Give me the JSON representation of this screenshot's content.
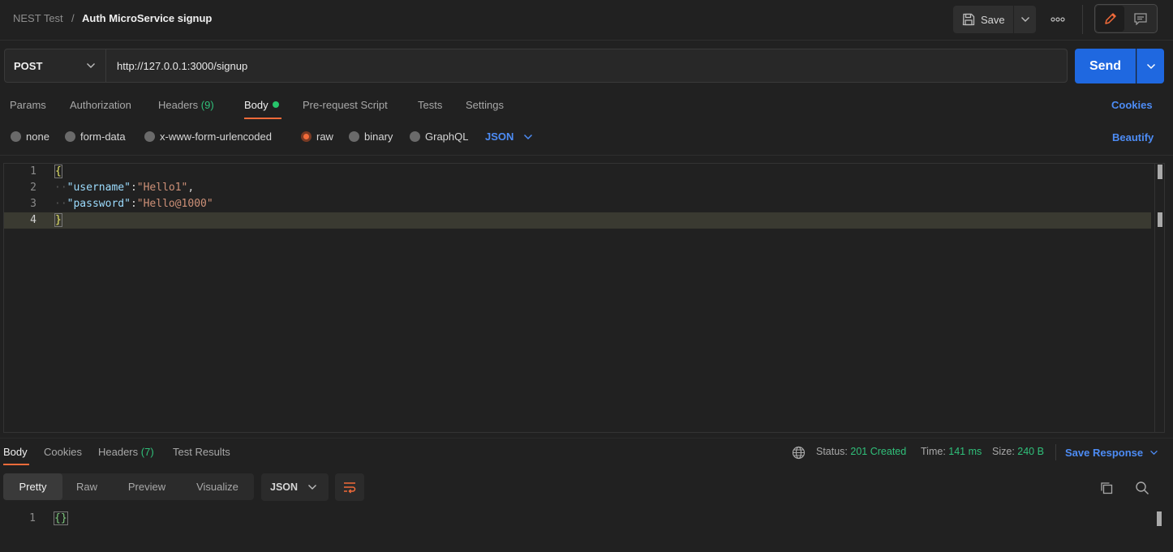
{
  "breadcrumb": {
    "collection": "NEST Test",
    "separator": "/",
    "request": "Auth MicroService signup"
  },
  "header": {
    "save_label": "Save"
  },
  "request": {
    "method": "POST",
    "url": "http://127.0.0.1:3000/signup",
    "send_label": "Send"
  },
  "request_tabs": {
    "params": "Params",
    "authorization": "Authorization",
    "headers": "Headers",
    "headers_count": "(9)",
    "body": "Body",
    "prerequest": "Pre-request Script",
    "tests": "Tests",
    "settings": "Settings",
    "cookies": "Cookies"
  },
  "body_types": {
    "none": "none",
    "form_data": "form-data",
    "urlencoded": "x-www-form-urlencoded",
    "raw": "raw",
    "binary": "binary",
    "graphql": "GraphQL",
    "language": "JSON",
    "beautify": "Beautify",
    "selected": "raw"
  },
  "editor": {
    "lines": [
      {
        "n": "1",
        "text": "{"
      },
      {
        "n": "2",
        "text": "\"username\":\"Hello1\","
      },
      {
        "n": "3",
        "text": "\"password\":\"Hello@1000\""
      },
      {
        "n": "4",
        "text": "}"
      }
    ],
    "key1": "\"username\"",
    "val1": "\"Hello1\"",
    "key2": "\"password\"",
    "val2": "\"Hello@1000\""
  },
  "response": {
    "tabs": {
      "body": "Body",
      "cookies": "Cookies",
      "headers": "Headers",
      "headers_count": "(7)",
      "test_results": "Test Results"
    },
    "status_label": "Status:",
    "status_value": "201 Created",
    "time_label": "Time:",
    "time_value": "141 ms",
    "size_label": "Size:",
    "size_value": "240 B",
    "save_response": "Save Response",
    "view_modes": {
      "pretty": "Pretty",
      "raw": "Raw",
      "preview": "Preview",
      "visualize": "Visualize"
    },
    "format": "JSON",
    "lines": [
      {
        "n": "1",
        "text": "{}"
      }
    ]
  },
  "colors": {
    "accent_orange": "#f26b3a",
    "send_blue": "#1f68e0",
    "link_blue": "#4d8cf5",
    "success_green": "#30c07a"
  },
  "icons": [
    "save-icon",
    "chevron-down-icon",
    "more-icon",
    "pencil-icon",
    "comment-icon",
    "globe-icon",
    "copy-icon",
    "search-icon",
    "wrap-lines-icon"
  ]
}
